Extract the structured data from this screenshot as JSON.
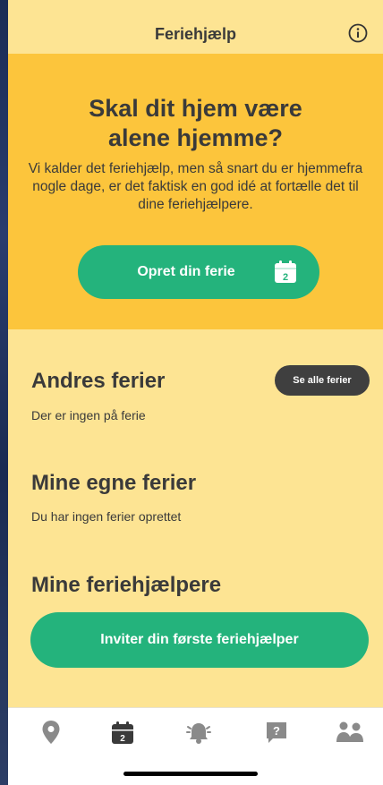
{
  "header": {
    "title": "Feriehjælp",
    "info_icon": "info-circle-icon"
  },
  "hero": {
    "headline": "Skal dit hjem være alene hjemme?",
    "description": "Vi kalder det feriehjælp, men så snart du er hjemmefra nogle dage, er det faktisk en god idé at fortælle det til dine feriehjælpere.",
    "create_button": "Opret din ferie",
    "calendar_day": "2"
  },
  "others": {
    "title": "Andres ferier",
    "see_all": "Se alle ferier",
    "empty": "Der er ingen på ferie"
  },
  "mine": {
    "title": "Mine egne ferier",
    "empty": "Du har ingen ferier oprettet"
  },
  "helpers": {
    "title": "Mine feriehjælpere",
    "invite_button": "Inviter din første feriehjælper"
  },
  "tabbar": {
    "calendar_day": "2",
    "help_glyph": "?",
    "icons": [
      "location-pin-icon",
      "calendar-icon",
      "alarm-bell-icon",
      "help-question-icon",
      "people-icon"
    ]
  },
  "colors": {
    "page_bg": "#fde493",
    "hero_bg": "#fcc53c",
    "primary_green": "#24b37c",
    "dark_button": "#3f3f3f",
    "text": "#3a3a3a",
    "tab_icon": "#8a8a8a"
  }
}
